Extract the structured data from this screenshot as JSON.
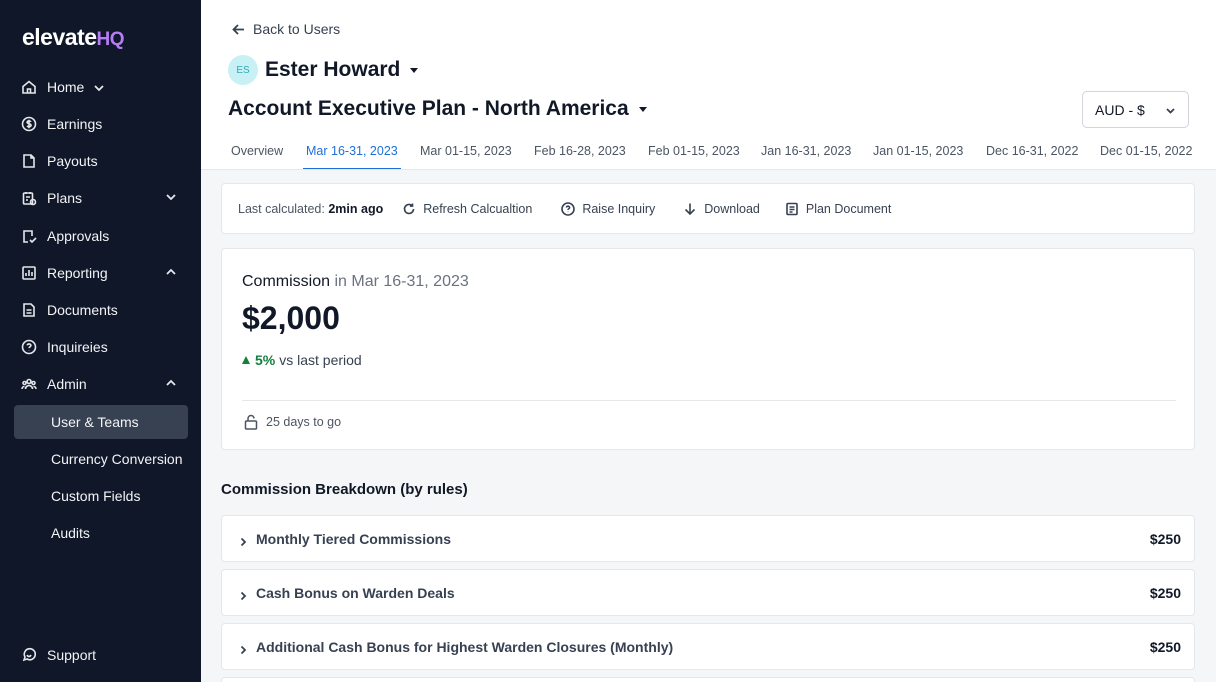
{
  "brand": {
    "name": "elevate",
    "suffix": "HQ",
    "suffix_color": "#b77cf5"
  },
  "sidebar": {
    "items": [
      {
        "label": "Home",
        "icon": "home-icon"
      },
      {
        "label": "Earnings",
        "icon": "dollar-icon"
      },
      {
        "label": "Payouts",
        "icon": "payouts-icon"
      },
      {
        "label": "Plans",
        "icon": "plans-icon"
      },
      {
        "label": "Approvals",
        "icon": "approvals-icon"
      },
      {
        "label": "Reporting",
        "icon": "reporting-icon"
      },
      {
        "label": "Documents",
        "icon": "document-icon"
      },
      {
        "label": "Inquireies",
        "icon": "help-icon"
      },
      {
        "label": "Admin",
        "icon": "team-icon"
      }
    ],
    "admin_sub": [
      {
        "label": "User & Teams",
        "active": true
      },
      {
        "label": "Currency Conversion"
      },
      {
        "label": "Custom Fields"
      },
      {
        "label": "Audits"
      }
    ],
    "support": {
      "label": "Support",
      "icon": "chat-icon"
    },
    "bg_color": "#0f1728"
  },
  "header": {
    "back_label": "Back to Users",
    "user_initials": "ES",
    "user_name": "Ester Howard",
    "plan_title": "Account Executive Plan - North America",
    "currency": "AUD - $"
  },
  "tabs": [
    {
      "label": "Overview"
    },
    {
      "label": "Mar 16-31, 2023",
      "active": true
    },
    {
      "label": "Mar 01-15, 2023"
    },
    {
      "label": "Feb 16-28, 2023"
    },
    {
      "label": "Feb 01-15, 2023"
    },
    {
      "label": "Jan 16-31, 2023"
    },
    {
      "label": "Jan 01-15, 2023"
    },
    {
      "label": "Dec 16-31, 2022"
    },
    {
      "label": "Dec 01-15, 2022"
    }
  ],
  "toolbar": {
    "last_calc_label": "Last calculated:",
    "last_calc_value": "2min ago",
    "refresh": "Refresh Calcualtion",
    "inquiry": "Raise Inquiry",
    "download": "Download",
    "plan_doc": "Plan Document"
  },
  "commission": {
    "label": "Commission",
    "period": "in Mar 16-31, 2023",
    "amount": "$2,000",
    "change_pct": "5%",
    "change_text": "vs last period",
    "days_left": "25 days to go",
    "positive_color": "#15803d"
  },
  "breakdown": {
    "title": "Commission Breakdown (by rules)",
    "rules": [
      {
        "name": "Monthly Tiered Commissions",
        "amount": "$250"
      },
      {
        "name": "Cash Bonus on Warden Deals",
        "amount": "$250"
      },
      {
        "name": "Additional Cash Bonus for Highest Warden Closures (Monthly)",
        "amount": "$250"
      }
    ]
  },
  "accent_color": "#1d6fd8"
}
